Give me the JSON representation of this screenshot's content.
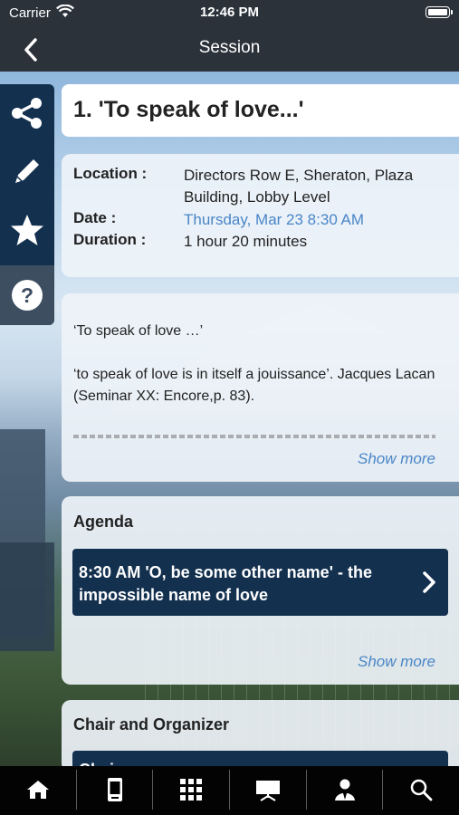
{
  "status": {
    "carrier": "Carrier",
    "time": "12:46 PM"
  },
  "nav": {
    "title": "Session"
  },
  "session": {
    "title": "1. 'To speak of love...'"
  },
  "info": {
    "location_label": "Location :",
    "location_value": "Directors Row E, Sheraton, Plaza Building, Lobby Level",
    "date_label": "Date :",
    "date_value": "Thursday, Mar 23 8:30 AM",
    "duration_label": "Duration :",
    "duration_value": "1 hour 20 minutes"
  },
  "description": {
    "line1": "‘To speak of love …’",
    "line2": "‘to speak of love is in itself a jouissance’. Jacques Lacan (Seminar XX: Encore,p. 83).",
    "show_more": "Show more"
  },
  "agenda": {
    "heading": "Agenda",
    "item_text": "8:30 AM  'O, be some other name' - the impossible name of love",
    "show_more": "Show more"
  },
  "chair": {
    "heading": "Chair and Organizer",
    "bar_text": "Chair"
  },
  "rail": {
    "icons": [
      "share-icon",
      "pencil-icon",
      "star-icon",
      "help-icon"
    ]
  },
  "tabs": [
    "home-icon",
    "mobile-icon",
    "grid-icon",
    "presentation-icon",
    "person-icon",
    "search-icon"
  ],
  "colors": {
    "navy": "#13304f",
    "link": "#4a86c8",
    "topbar": "#2b323a"
  }
}
